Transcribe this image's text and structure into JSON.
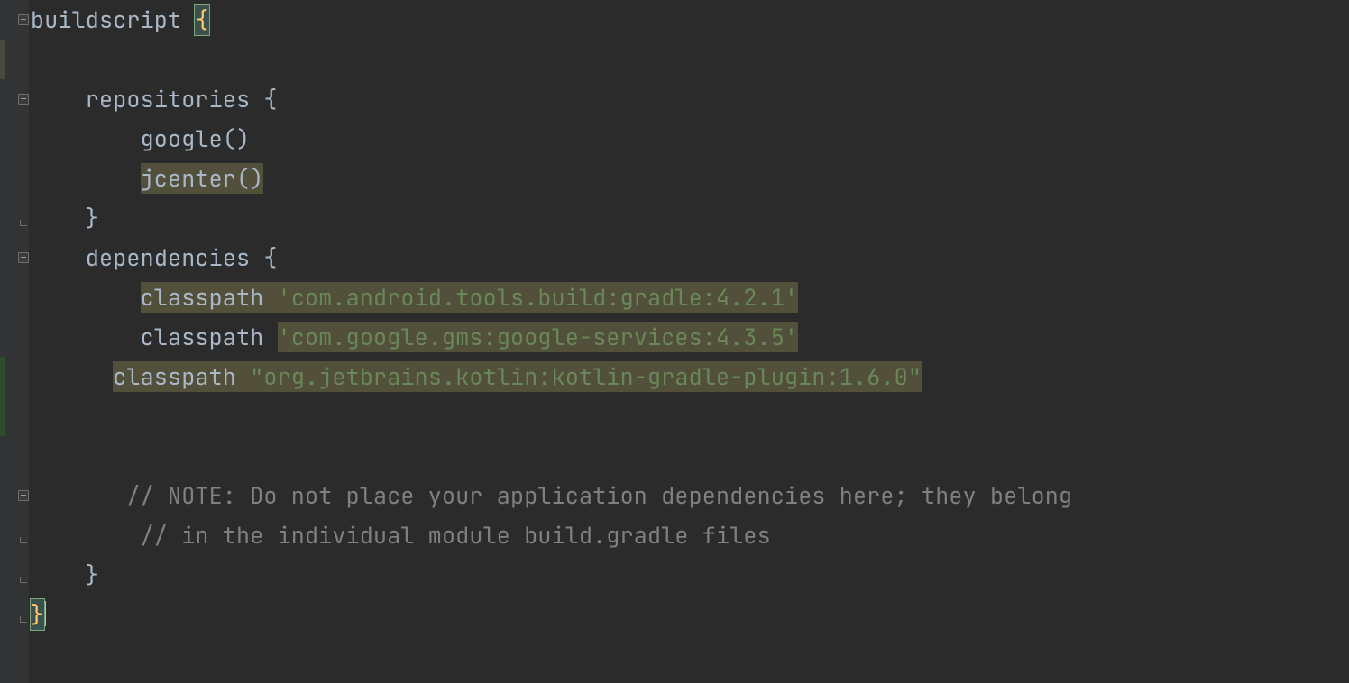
{
  "editor": {
    "language": "Gradle Groovy",
    "lines": [
      {
        "indent": 0,
        "segments": [
          {
            "t": "buildscript ",
            "c": "txt"
          },
          {
            "t": "{",
            "c": "brace-yellow",
            "hi": "caret-bg caret-brace"
          }
        ],
        "fold": "open",
        "change": "none"
      },
      {
        "indent": 0,
        "segments": [],
        "change": "mod"
      },
      {
        "indent": 4,
        "segments": [
          {
            "t": "repositories ",
            "c": "txt"
          },
          {
            "t": "{",
            "c": "txt"
          }
        ],
        "fold": "open",
        "change": "none"
      },
      {
        "indent": 8,
        "segments": [
          {
            "t": "google()",
            "c": "txt"
          }
        ],
        "change": "none"
      },
      {
        "indent": 8,
        "segments": [
          {
            "t": "jcenter()",
            "c": "txt",
            "hi": "hi-warn"
          }
        ],
        "change": "none"
      },
      {
        "indent": 4,
        "segments": [
          {
            "t": "}",
            "c": "txt"
          }
        ],
        "fold": "close",
        "change": "none"
      },
      {
        "indent": 4,
        "segments": [
          {
            "t": "dependencies ",
            "c": "txt"
          },
          {
            "t": "{",
            "c": "txt"
          }
        ],
        "fold": "open",
        "change": "none"
      },
      {
        "indent": 8,
        "segments": [
          {
            "t": "classpath ",
            "c": "txt",
            "hi": "hi-warn"
          },
          {
            "t": "'com.android.tools.build:gradle:4.2.1'",
            "c": "str",
            "hi": "hi-warn"
          }
        ],
        "change": "none"
      },
      {
        "indent": 8,
        "segments": [
          {
            "t": "classpath ",
            "c": "txt"
          },
          {
            "t": "'com.google.gms:google-services:4.3.5'",
            "c": "str",
            "hi": "hi-warn"
          }
        ],
        "change": "none"
      },
      {
        "indent": 6,
        "segments": [
          {
            "t": "classpath ",
            "c": "txt",
            "hi": "hi-warn"
          },
          {
            "t": "\"org.jetbrains.kotlin:kotlin-gradle-plugin:1.6.0\"",
            "c": "str",
            "hi": "hi-warn"
          }
        ],
        "change": "add"
      },
      {
        "indent": 0,
        "segments": [],
        "change": "add"
      },
      {
        "indent": 0,
        "segments": [],
        "change": "none"
      },
      {
        "indent": 7,
        "segments": [
          {
            "t": "// NOTE: Do not place your application dependencies here; they belong",
            "c": "cm"
          }
        ],
        "fold": "open",
        "change": "none"
      },
      {
        "indent": 8,
        "segments": [
          {
            "t": "// in the individual module build.gradle files",
            "c": "cm"
          }
        ],
        "fold": "close",
        "change": "none"
      },
      {
        "indent": 4,
        "segments": [
          {
            "t": "}",
            "c": "txt"
          }
        ],
        "fold": "close",
        "change": "none"
      },
      {
        "indent": 0,
        "segments": [
          {
            "t": "}",
            "c": "brace-yellow",
            "hi": "caret-bg caret-brace",
            "caret_after": true
          }
        ],
        "fold": "close",
        "change": "none"
      }
    ]
  }
}
